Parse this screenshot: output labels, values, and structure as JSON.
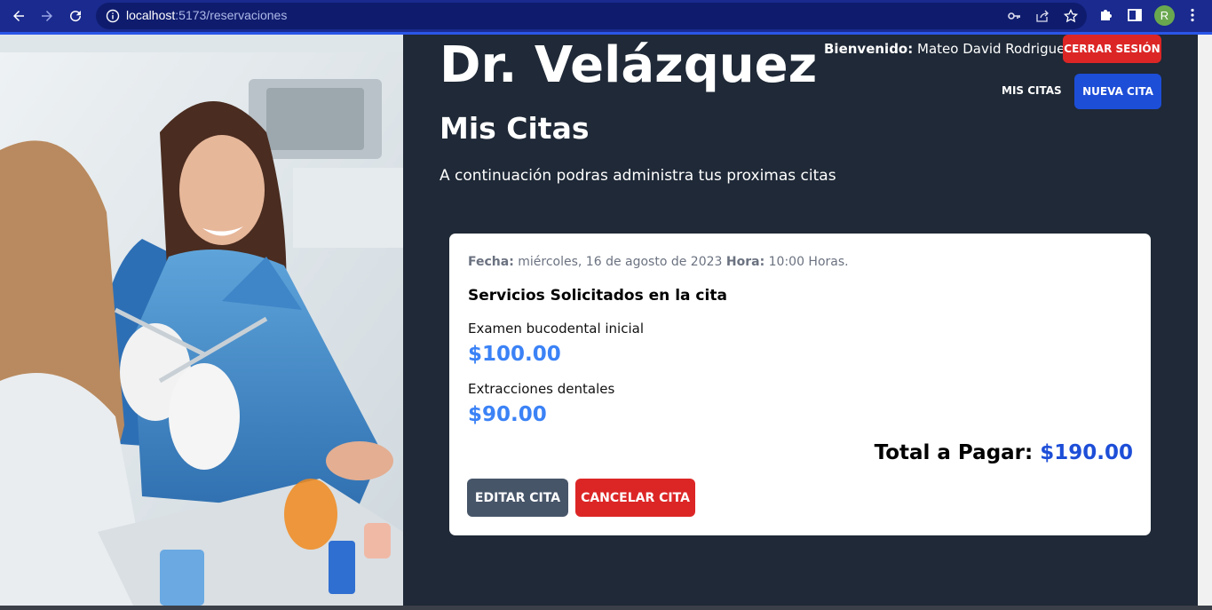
{
  "browser": {
    "url_host": "localhost",
    "url_path": ":5173/reservaciones",
    "profile_initial": "R",
    "icons": [
      "back-icon",
      "forward-icon",
      "reload-icon",
      "info-icon",
      "key-icon",
      "share-icon",
      "star-icon",
      "puzzle-icon",
      "side-panel-icon",
      "kebab-menu-icon"
    ]
  },
  "header": {
    "brand": "Dr. Velázquez",
    "welcome_label": "Bienvenido:",
    "user_name": " Mateo David Rodriguez",
    "logout_label": "Cerrar Sesión",
    "nav_my_appointments": "Mis Citas",
    "nav_new_appointment": "Nueva Cita"
  },
  "main": {
    "title": "Mis Citas",
    "description": "A continuación podras administra tus proximas citas"
  },
  "appointment": {
    "date_label": "Fecha:",
    "date_value": " miércoles, 16 de agosto de 2023 ",
    "time_label": "Hora:",
    "time_value": " 10:00 Horas.",
    "services_title": "Servicios Solicitados en la cita",
    "services": [
      {
        "name": "Examen bucodental inicial",
        "price": "$100.00"
      },
      {
        "name": "Extracciones dentales",
        "price": "$90.00"
      }
    ],
    "total_label": "Total a Pagar: ",
    "total_value": "$190.00",
    "edit_label": "Editar Cita",
    "cancel_label": "Cancelar Cita"
  },
  "colors": {
    "background": "#1f2937",
    "primary_blue": "#1d4ed8",
    "price_blue": "#3b82f6",
    "danger_red": "#dc2626",
    "slate": "#475569",
    "chrome_blue": "#1a2a8e"
  }
}
